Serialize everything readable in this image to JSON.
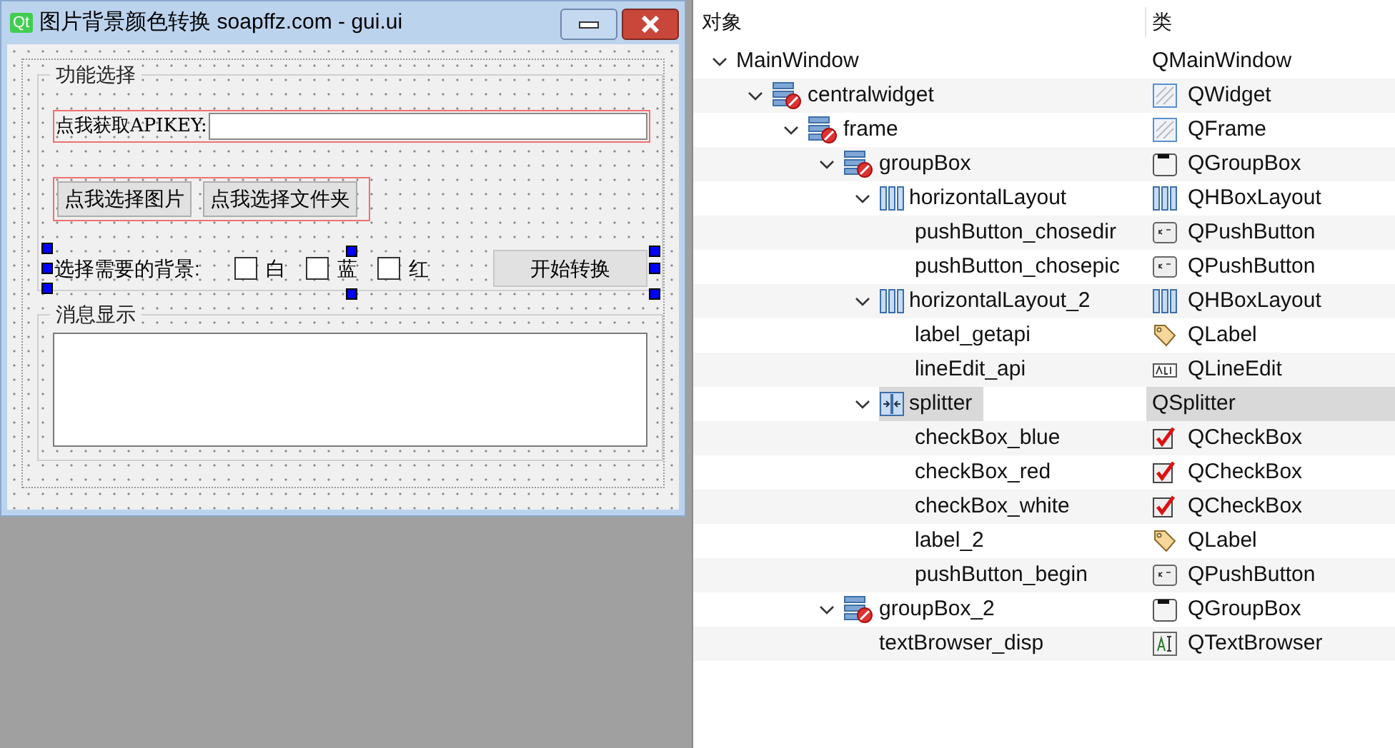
{
  "window": {
    "logo_text": "Qt",
    "title": "图片背景颜色转换 soapffz.com - gui.ui"
  },
  "group_1": {
    "title": "功能选择",
    "api_label": "点我获取APIKEY:",
    "buttons": [
      "点我选择图片",
      "点我选择文件夹"
    ]
  },
  "background_row": {
    "selected": true,
    "label": "选择需要的背景:",
    "checkboxes": [
      {
        "label": "白",
        "checked": false
      },
      {
        "label": "蓝",
        "checked": false
      },
      {
        "label": "红",
        "checked": false
      }
    ],
    "start_button": "开始转换"
  },
  "group_2": {
    "title": "消息显示"
  },
  "object_inspector": {
    "columns": [
      "对象",
      "类"
    ],
    "tree": [
      {
        "name": "MainWindow",
        "class": "QMainWindow",
        "expanded": true,
        "selected": false,
        "children": [
          {
            "name": "centralwidget",
            "class": "QWidget",
            "kind": "widget",
            "expanded": true,
            "selected": false,
            "children": [
              {
                "name": "frame",
                "class": "QFrame",
                "kind": "frame",
                "expanded": true,
                "selected": false,
                "children": [
                  {
                    "name": "groupBox",
                    "class": "QGroupBox",
                    "kind": "groupbox",
                    "expanded": true,
                    "selected": false,
                    "children": [
                      {
                        "name": "horizontalLayout",
                        "class": "QHBoxLayout",
                        "kind": "hlayout",
                        "expanded": true,
                        "selected": false,
                        "children": [
                          {
                            "name": "pushButton_chosedir",
                            "class": "QPushButton",
                            "kind": "button",
                            "selected": false
                          },
                          {
                            "name": "pushButton_chosepic",
                            "class": "QPushButton",
                            "kind": "button",
                            "selected": false
                          }
                        ]
                      },
                      {
                        "name": "horizontalLayout_2",
                        "class": "QHBoxLayout",
                        "kind": "hlayout",
                        "expanded": true,
                        "selected": false,
                        "children": [
                          {
                            "name": "label_getapi",
                            "class": "QLabel",
                            "kind": "label",
                            "selected": false
                          },
                          {
                            "name": "lineEdit_api",
                            "class": "QLineEdit",
                            "kind": "lineedit",
                            "selected": false
                          }
                        ]
                      },
                      {
                        "name": "splitter",
                        "class": "QSplitter",
                        "kind": "splitter",
                        "expanded": true,
                        "selected": true,
                        "children": [
                          {
                            "name": "checkBox_blue",
                            "class": "QCheckBox",
                            "kind": "checkbox",
                            "selected": false
                          },
                          {
                            "name": "checkBox_red",
                            "class": "QCheckBox",
                            "kind": "checkbox",
                            "selected": false
                          },
                          {
                            "name": "checkBox_white",
                            "class": "QCheckBox",
                            "kind": "checkbox",
                            "selected": false
                          },
                          {
                            "name": "label_2",
                            "class": "QLabel",
                            "kind": "label",
                            "selected": false
                          },
                          {
                            "name": "pushButton_begin",
                            "class": "QPushButton",
                            "kind": "button",
                            "selected": false
                          }
                        ]
                      }
                    ]
                  },
                  {
                    "name": "groupBox_2",
                    "class": "QGroupBox",
                    "kind": "groupbox",
                    "expanded": true,
                    "selected": false,
                    "children": [
                      {
                        "name": "textBrowser_disp",
                        "class": "QTextBrowser",
                        "kind": "textbrowser",
                        "selected": false
                      }
                    ]
                  }
                ]
              }
            ]
          }
        ]
      }
    ]
  }
}
